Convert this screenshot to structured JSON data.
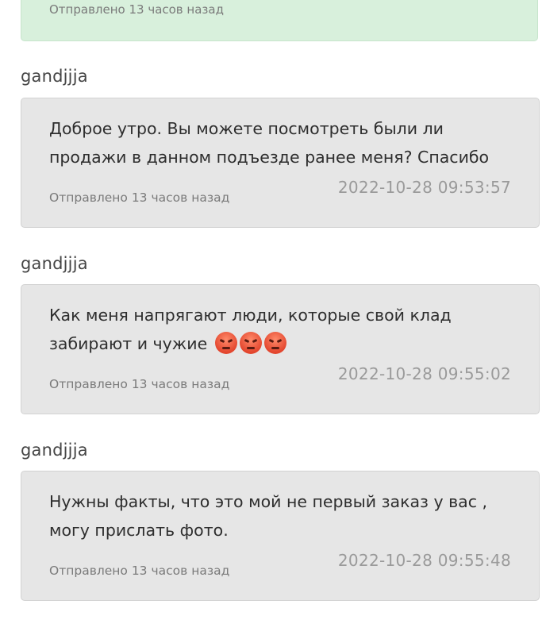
{
  "top_message": {
    "meta": "Отправлено 13 часов назад"
  },
  "messages": [
    {
      "author": "gandjjja",
      "text": "Доброе утро. Вы можете посмотреть были ли продажи в данном подъезде ранее меня? Спасибо",
      "timestamp": "2022-10-28 09:53:57",
      "sent": "Отправлено 13 часов назад"
    },
    {
      "author": "gandjjja",
      "text": "Как меня напрягают люди, которые свой клад забирают и чужие",
      "emojis": [
        "pouting-face-icon",
        "pouting-face-icon",
        "pouting-face-icon"
      ],
      "timestamp": "2022-10-28 09:55:02",
      "sent": "Отправлено 13 часов назад"
    },
    {
      "author": "gandjjja",
      "text": "Нужны факты, что это мой не первый заказ у вас , могу прислать фото.",
      "timestamp": "2022-10-28 09:55:48",
      "sent": "Отправлено 13 часов назад"
    }
  ]
}
